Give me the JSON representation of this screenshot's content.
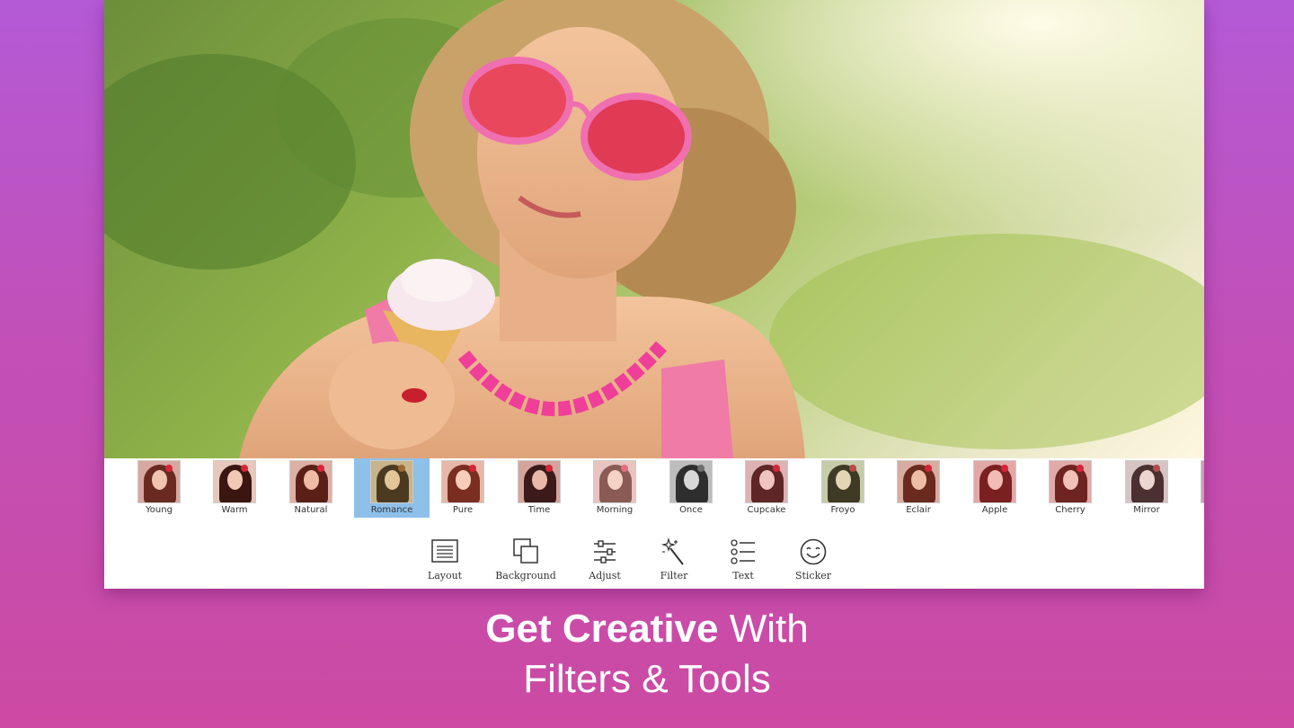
{
  "filters": {
    "items": [
      {
        "label": "Young",
        "selected": false
      },
      {
        "label": "Warm",
        "selected": false
      },
      {
        "label": "Natural",
        "selected": false
      },
      {
        "label": "Romance",
        "selected": true
      },
      {
        "label": "Pure",
        "selected": false
      },
      {
        "label": "Time",
        "selected": false
      },
      {
        "label": "Morning",
        "selected": false
      },
      {
        "label": "Once",
        "selected": false
      },
      {
        "label": "Cupcake",
        "selected": false
      },
      {
        "label": "Froyo",
        "selected": false
      },
      {
        "label": "Eclair",
        "selected": false
      },
      {
        "label": "Apple",
        "selected": false
      },
      {
        "label": "Cherry",
        "selected": false
      },
      {
        "label": "Mirror",
        "selected": false
      }
    ]
  },
  "toolbar": {
    "items": [
      {
        "label": "Layout",
        "icon": "layout-icon"
      },
      {
        "label": "Background",
        "icon": "background-icon"
      },
      {
        "label": "Adjust",
        "icon": "adjust-icon"
      },
      {
        "label": "Filter",
        "icon": "filter-wand-icon"
      },
      {
        "label": "Text",
        "icon": "text-list-icon"
      },
      {
        "label": "Sticker",
        "icon": "smiley-sticker-icon"
      }
    ]
  },
  "headline": {
    "bold": "Get Creative",
    "rest_line1": " With",
    "line2": "Filters & Tools"
  },
  "colors": {
    "selected_filter_bg": "#8ec0ea",
    "background_gradient_top": "#b45ad6",
    "background_gradient_bottom": "#cc4aa2"
  }
}
